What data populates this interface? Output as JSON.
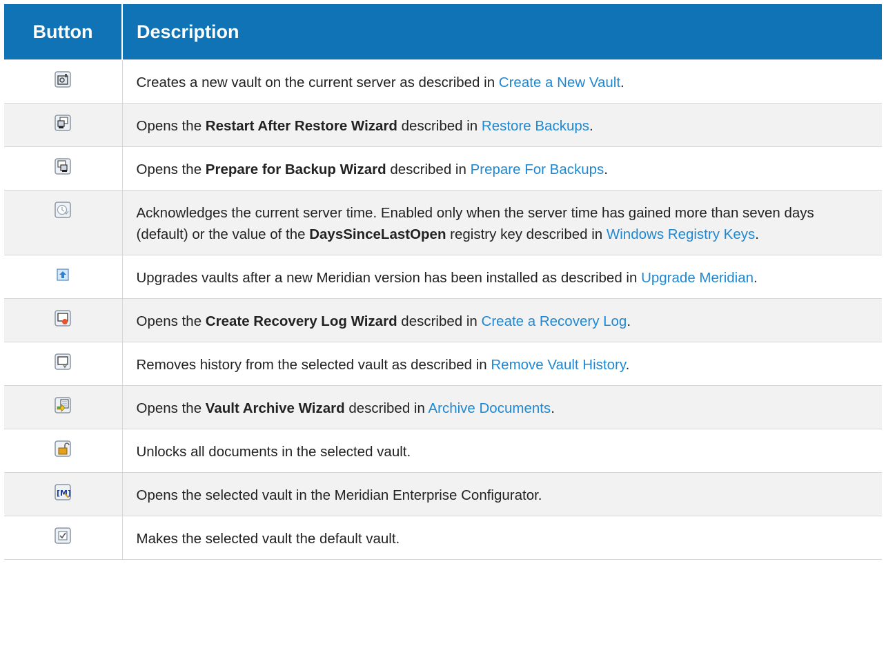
{
  "table": {
    "headers": {
      "button": "Button",
      "description": "Description"
    },
    "rows": [
      {
        "icon": "create-vault-icon",
        "parts": [
          {
            "t": "Creates a new vault on the current server as described in "
          },
          {
            "link": "Create a New Vault"
          },
          {
            "t": "."
          }
        ]
      },
      {
        "icon": "restart-after-restore-icon",
        "parts": [
          {
            "t": "Opens the "
          },
          {
            "b": "Restart After Restore Wizard"
          },
          {
            "t": " described in "
          },
          {
            "link": "Restore Backups"
          },
          {
            "t": "."
          }
        ]
      },
      {
        "icon": "prepare-backup-icon",
        "parts": [
          {
            "t": "Opens the "
          },
          {
            "b": "Prepare for Backup Wizard"
          },
          {
            "t": " described in "
          },
          {
            "link": "Prepare For Backups"
          },
          {
            "t": "."
          }
        ]
      },
      {
        "icon": "acknowledge-time-icon",
        "parts": [
          {
            "t": "Acknowledges the current server time. Enabled only when the server time has gained more than seven days (default) or the value of the "
          },
          {
            "b": "DaysSinceLastOpen"
          },
          {
            "t": " registry key described in "
          },
          {
            "link": "Windows Registry Keys"
          },
          {
            "t": "."
          }
        ]
      },
      {
        "icon": "upgrade-vaults-icon",
        "parts": [
          {
            "t": "Upgrades vaults after a new Meridian version has been installed as described in "
          },
          {
            "link": "Upgrade Meridian"
          },
          {
            "t": "."
          }
        ]
      },
      {
        "icon": "create-recovery-log-icon",
        "parts": [
          {
            "t": "Opens the "
          },
          {
            "b": "Create Recovery Log Wizard"
          },
          {
            "t": " described in "
          },
          {
            "link": "Create a Recovery Log"
          },
          {
            "t": "."
          }
        ]
      },
      {
        "icon": "remove-history-icon",
        "parts": [
          {
            "t": "Removes history from the selected vault as described in "
          },
          {
            "link": "Remove Vault History"
          },
          {
            "t": "."
          }
        ]
      },
      {
        "icon": "vault-archive-icon",
        "parts": [
          {
            "t": "Opens the "
          },
          {
            "b": "Vault Archive Wizard"
          },
          {
            "t": " described in "
          },
          {
            "link": "Archive Documents"
          },
          {
            "t": "."
          }
        ]
      },
      {
        "icon": "unlock-icon",
        "parts": [
          {
            "t": "Unlocks all documents in the selected vault."
          }
        ]
      },
      {
        "icon": "configurator-icon",
        "parts": [
          {
            "t": "Opens the selected vault in the Meridian Enterprise Configurator."
          }
        ]
      },
      {
        "icon": "default-vault-check-icon",
        "parts": [
          {
            "t": "Makes the selected vault the default vault."
          }
        ]
      }
    ]
  }
}
